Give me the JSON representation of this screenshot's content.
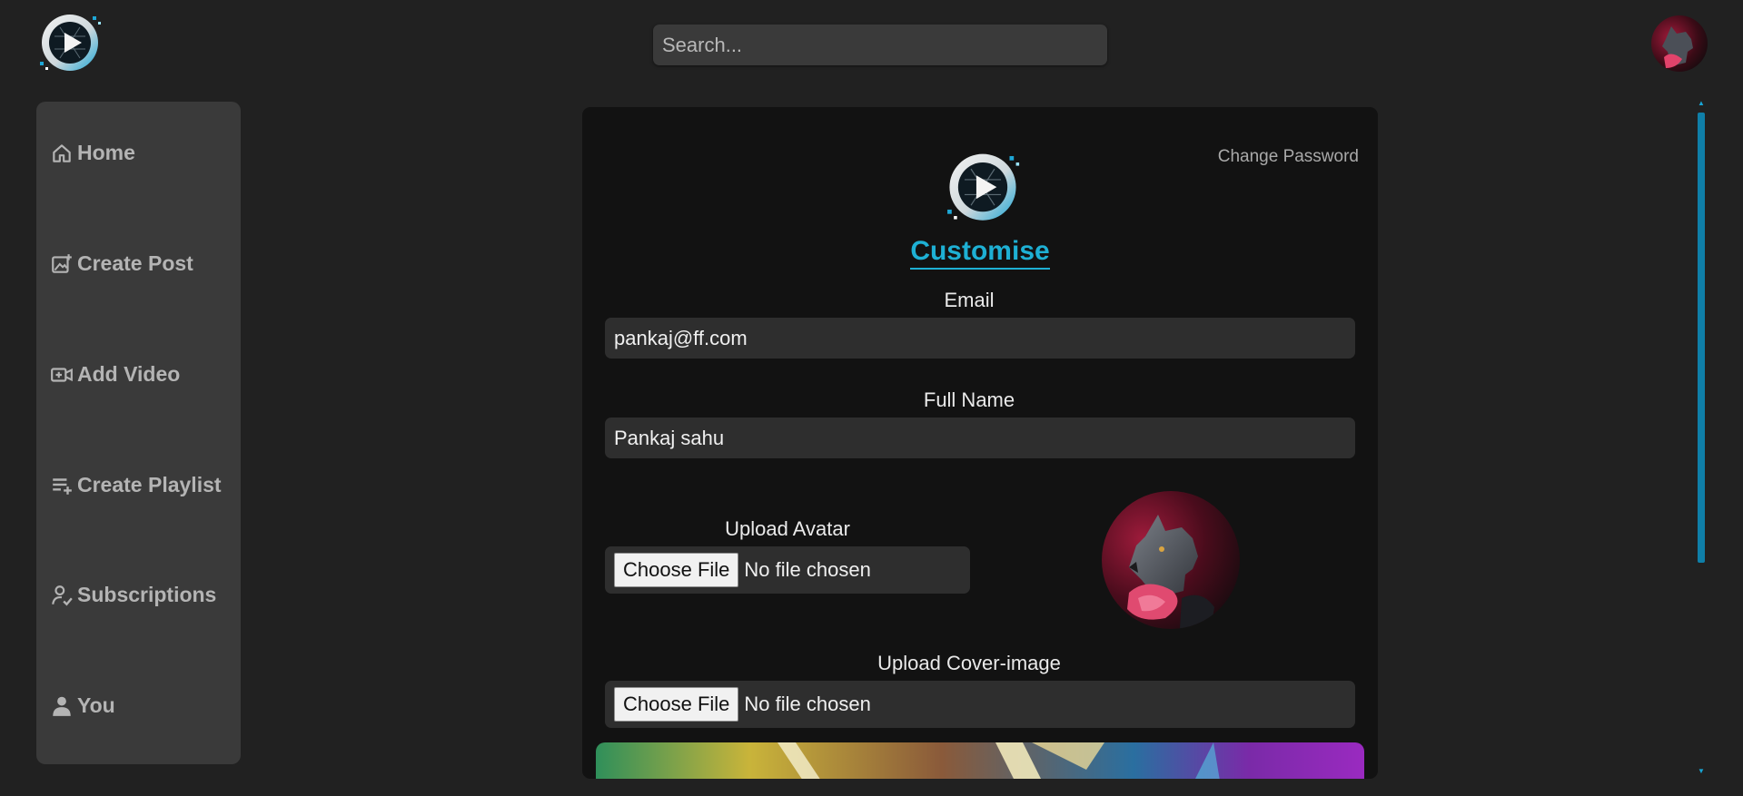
{
  "app": {
    "accent_color": "#1eb0d4",
    "background": "#212121"
  },
  "header": {
    "logo_icon": "play-logo-icon",
    "search": {
      "placeholder": "Search...",
      "value": ""
    },
    "avatar_icon": "user-avatar"
  },
  "sidebar": {
    "items": [
      {
        "label": "Home",
        "icon": "home-icon"
      },
      {
        "label": "Create Post",
        "icon": "image-add-icon"
      },
      {
        "label": "Add Video",
        "icon": "video-add-icon"
      },
      {
        "label": "Create Playlist",
        "icon": "playlist-add-icon"
      },
      {
        "label": "Subscriptions",
        "icon": "user-check-icon"
      },
      {
        "label": "You",
        "icon": "user-icon"
      }
    ]
  },
  "panel": {
    "change_password": "Change Password",
    "title": "Customise",
    "email_label": "Email",
    "email_value": "pankaj@ff.com",
    "fullname_label": "Full Name",
    "fullname_value": "Pankaj sahu",
    "avatar_label": "Upload Avatar",
    "avatar_button": "Choose File",
    "avatar_status": "No file chosen",
    "cover_label": "Upload Cover-image",
    "cover_button": "Choose File",
    "cover_status": "No file chosen"
  }
}
